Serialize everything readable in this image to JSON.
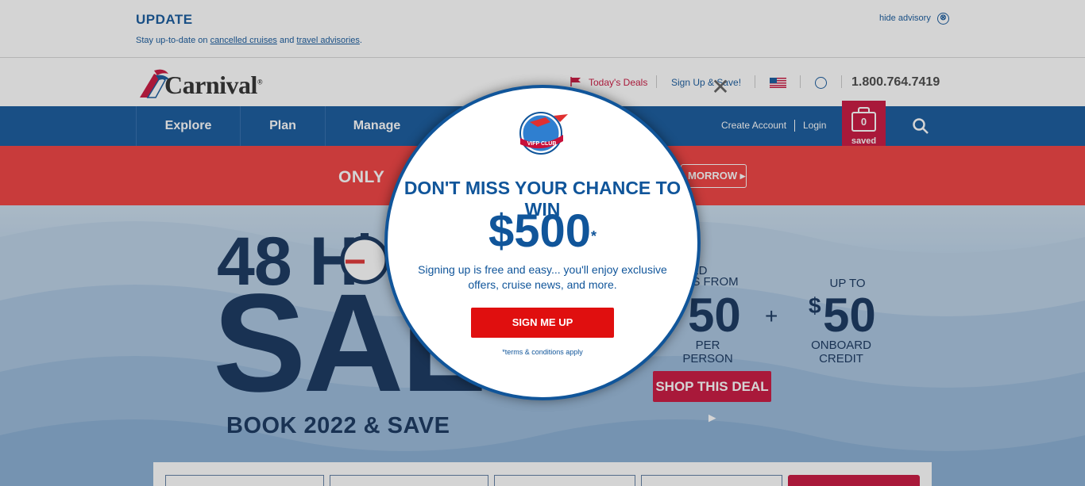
{
  "advisory": {
    "title": "UPDATE",
    "text_prefix": "Stay up-to-date on ",
    "link1": "cancelled cruises",
    "text_mid": " and ",
    "link2": "travel advisories",
    "text_suffix": ".",
    "hide_label": "hide advisory",
    "hide_icon": "⊗"
  },
  "header": {
    "logo_text": "Carnival",
    "logo_reg": "®",
    "deals_label": "Today's Deals",
    "signup_label": "Sign Up & Save!",
    "phone": "1.800.764.7419"
  },
  "nav": {
    "items": [
      "Explore",
      "Plan",
      "Manage"
    ],
    "create_account": "Create Account",
    "login": "Login",
    "saved_count": "0",
    "saved_label": "saved"
  },
  "promo": {
    "only": "ONLY",
    "tomorrow": "MORROW ▸"
  },
  "hero": {
    "headline_top": "48 H",
    "headline_main": "SALE",
    "book": "BOOK 2022 & SAVE",
    "deposit_label": "UCED\nSITS FROM",
    "deposit_value": "50",
    "deposit_unit": "PER PERSON",
    "plus": "+",
    "credit_label": "UP TO",
    "credit_dollar": "$",
    "credit_value": "50",
    "credit_unit": "ONBOARD CREDIT",
    "shop_label": "SHOP THIS DEAL ▸"
  },
  "modal": {
    "badge_text": "VIFP CLUB",
    "title": "DON'T MISS YOUR CHANCE TO WIN",
    "amount": "$500",
    "amount_mark": "*",
    "description": "Signing up is free and easy... you'll enjoy exclusive offers, cruise news, and more.",
    "button_label": "SIGN ME UP",
    "terms": "*terms & conditions apply",
    "close_symbol": "✕"
  },
  "colors": {
    "brand_blue": "#10559a",
    "brand_red": "#c8103a",
    "promo_red": "#f03b3b",
    "cta_red": "#e00f0f"
  }
}
